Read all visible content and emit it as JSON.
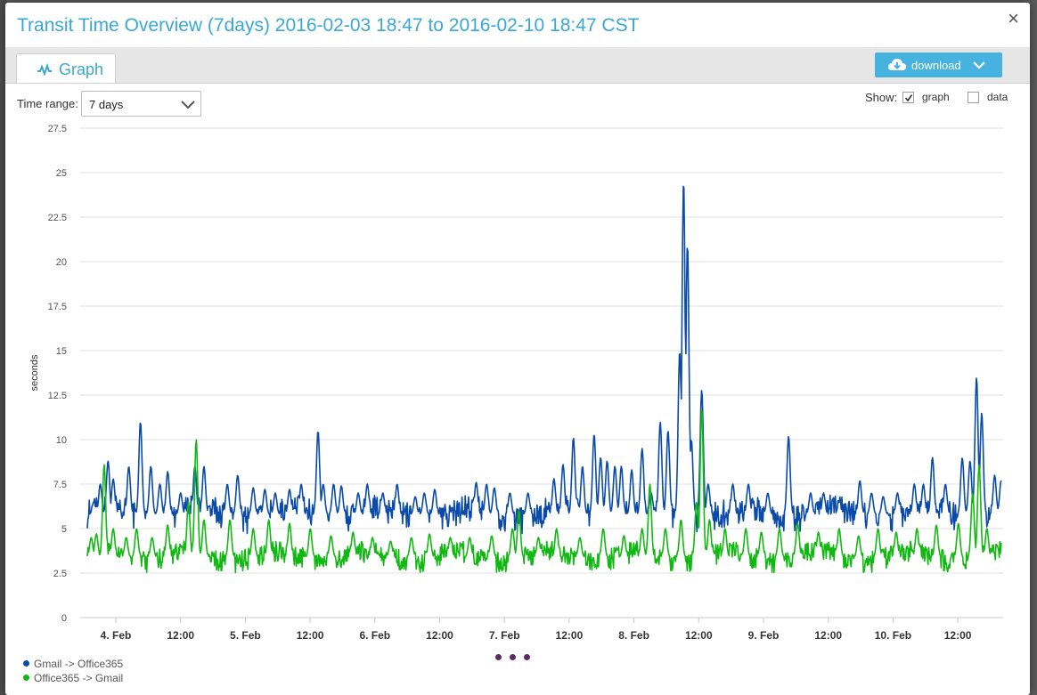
{
  "modal": {
    "title": "Transit Time Overview (7days) 2016-02-03 18:47 to 2016-02-10 18:47 CST",
    "close_label": "×"
  },
  "tabs": [
    {
      "label": "Graph",
      "icon": "line-chart-icon"
    }
  ],
  "download": {
    "label": "download",
    "icon": "cloud-download-icon"
  },
  "controls": {
    "time_range_label": "Time range:",
    "time_range_value": "7 days",
    "show_label": "Show:",
    "graph_label": "graph",
    "graph_checked": true,
    "data_label": "data",
    "data_checked": false
  },
  "colors": {
    "accent": "#3aa8d4",
    "series_blue": "#0a4aa8",
    "series_green": "#12b812",
    "pager": "#5a2a62"
  },
  "chart_data": {
    "type": "line",
    "ylabel": "seconds",
    "ylim": [
      0,
      27.5
    ],
    "yticks": [
      "0",
      "2.5",
      "5",
      "7.5",
      "10",
      "12.5",
      "15",
      "17.5",
      "20",
      "22.5",
      "25",
      "27.5"
    ],
    "xticks": [
      "4. Feb",
      "12:00",
      "5. Feb",
      "12:00",
      "6. Feb",
      "12:00",
      "7. Feb",
      "12:00",
      "8. Feb",
      "12:00",
      "9. Feb",
      "12:00",
      "10. Feb",
      "12:00"
    ],
    "x_start": "2016-02-03 18:47",
    "x_end": "2016-02-10 18:47",
    "grid": true,
    "legend": "bottom-left",
    "series": [
      {
        "name": "Gmail -> Office365",
        "color": "#0a4aa8",
        "baseline": 5.8,
        "peaks": [
          {
            "t": 0.05,
            "v": 6.5
          },
          {
            "t": 0.1,
            "v": 7.5
          },
          {
            "t": 0.16,
            "v": 8.8
          },
          {
            "t": 0.2,
            "v": 7.8
          },
          {
            "t": 0.32,
            "v": 8.5
          },
          {
            "t": 0.41,
            "v": 11.0
          },
          {
            "t": 0.49,
            "v": 8.5
          },
          {
            "t": 0.56,
            "v": 7.5
          },
          {
            "t": 0.62,
            "v": 8.2
          },
          {
            "t": 0.72,
            "v": 7.0
          },
          {
            "t": 0.83,
            "v": 8.5
          },
          {
            "t": 0.9,
            "v": 8.5
          },
          {
            "t": 1.08,
            "v": 7.5
          },
          {
            "t": 1.16,
            "v": 8.0
          },
          {
            "t": 1.28,
            "v": 7.3
          },
          {
            "t": 1.37,
            "v": 7.2
          },
          {
            "t": 1.45,
            "v": 7.0
          },
          {
            "t": 1.56,
            "v": 7.2
          },
          {
            "t": 1.65,
            "v": 7.5
          },
          {
            "t": 1.78,
            "v": 10.5
          },
          {
            "t": 1.82,
            "v": 7.5
          },
          {
            "t": 1.9,
            "v": 7.5
          },
          {
            "t": 1.96,
            "v": 7.4
          },
          {
            "t": 2.09,
            "v": 7.0
          },
          {
            "t": 2.16,
            "v": 7.5
          },
          {
            "t": 2.28,
            "v": 7.0
          },
          {
            "t": 2.39,
            "v": 7.5
          },
          {
            "t": 2.53,
            "v": 6.8
          },
          {
            "t": 2.6,
            "v": 7.0
          },
          {
            "t": 2.68,
            "v": 7.2
          },
          {
            "t": 3.0,
            "v": 7.6
          },
          {
            "t": 3.08,
            "v": 7.5
          },
          {
            "t": 3.14,
            "v": 7.3
          },
          {
            "t": 3.26,
            "v": 7.0
          },
          {
            "t": 3.4,
            "v": 7.0
          },
          {
            "t": 3.6,
            "v": 7.8
          },
          {
            "t": 3.67,
            "v": 8.6
          },
          {
            "t": 3.75,
            "v": 10.1
          },
          {
            "t": 3.82,
            "v": 8.5
          },
          {
            "t": 3.91,
            "v": 10.3
          },
          {
            "t": 3.96,
            "v": 9.0
          },
          {
            "t": 4.01,
            "v": 8.8
          },
          {
            "t": 4.07,
            "v": 8.5
          },
          {
            "t": 4.12,
            "v": 8.5
          },
          {
            "t": 4.2,
            "v": 8.3
          },
          {
            "t": 4.28,
            "v": 9.5
          },
          {
            "t": 4.35,
            "v": 7.0
          },
          {
            "t": 4.42,
            "v": 11.0
          },
          {
            "t": 4.48,
            "v": 10.5
          },
          {
            "t": 4.57,
            "v": 15.0
          },
          {
            "t": 4.6,
            "v": 24.6
          },
          {
            "t": 4.63,
            "v": 21.0
          },
          {
            "t": 4.66,
            "v": 10.0
          },
          {
            "t": 4.74,
            "v": 12.8
          },
          {
            "t": 4.79,
            "v": 7.5
          },
          {
            "t": 4.98,
            "v": 7.5
          },
          {
            "t": 5.1,
            "v": 7.5
          },
          {
            "t": 5.25,
            "v": 7.0
          },
          {
            "t": 5.41,
            "v": 10.2
          },
          {
            "t": 5.58,
            "v": 7.0
          },
          {
            "t": 5.68,
            "v": 7.0
          },
          {
            "t": 5.8,
            "v": 6.5
          },
          {
            "t": 5.96,
            "v": 7.7
          },
          {
            "t": 6.05,
            "v": 7.0
          },
          {
            "t": 6.14,
            "v": 6.8
          },
          {
            "t": 6.25,
            "v": 7.0
          },
          {
            "t": 6.38,
            "v": 7.5
          },
          {
            "t": 6.45,
            "v": 7.5
          },
          {
            "t": 6.52,
            "v": 9.0
          },
          {
            "t": 6.62,
            "v": 7.5
          },
          {
            "t": 6.75,
            "v": 9.0
          },
          {
            "t": 6.81,
            "v": 8.8
          },
          {
            "t": 6.86,
            "v": 13.5
          },
          {
            "t": 6.9,
            "v": 11.5
          },
          {
            "t": 7.0,
            "v": 8.0
          },
          {
            "t": 7.05,
            "v": 7.7
          }
        ]
      },
      {
        "name": "Office365 -> Gmail",
        "color": "#12b812",
        "baseline": 3.4,
        "peaks": [
          {
            "t": 0.03,
            "v": 4.5
          },
          {
            "t": 0.07,
            "v": 4.7
          },
          {
            "t": 0.13,
            "v": 8.6
          },
          {
            "t": 0.2,
            "v": 5.0
          },
          {
            "t": 0.3,
            "v": 4.5
          },
          {
            "t": 0.38,
            "v": 5.0
          },
          {
            "t": 0.5,
            "v": 4.5
          },
          {
            "t": 0.62,
            "v": 5.2
          },
          {
            "t": 0.78,
            "v": 6.5
          },
          {
            "t": 0.84,
            "v": 10.0
          },
          {
            "t": 0.9,
            "v": 5.5
          },
          {
            "t": 1.1,
            "v": 5.5
          },
          {
            "t": 1.28,
            "v": 5.0
          },
          {
            "t": 1.4,
            "v": 5.5
          },
          {
            "t": 1.56,
            "v": 5.3
          },
          {
            "t": 1.72,
            "v": 5.0
          },
          {
            "t": 1.88,
            "v": 4.6
          },
          {
            "t": 2.05,
            "v": 4.8
          },
          {
            "t": 2.2,
            "v": 4.5
          },
          {
            "t": 2.34,
            "v": 4.3
          },
          {
            "t": 2.5,
            "v": 4.5
          },
          {
            "t": 2.64,
            "v": 4.7
          },
          {
            "t": 2.8,
            "v": 4.5
          },
          {
            "t": 2.95,
            "v": 4.5
          },
          {
            "t": 3.12,
            "v": 4.6
          },
          {
            "t": 3.28,
            "v": 5.0
          },
          {
            "t": 3.33,
            "v": 6.0
          },
          {
            "t": 3.48,
            "v": 4.5
          },
          {
            "t": 3.62,
            "v": 5.0
          },
          {
            "t": 3.8,
            "v": 4.5
          },
          {
            "t": 3.98,
            "v": 5.0
          },
          {
            "t": 4.14,
            "v": 4.6
          },
          {
            "t": 4.28,
            "v": 5.0
          },
          {
            "t": 4.34,
            "v": 7.5
          },
          {
            "t": 4.46,
            "v": 5.0
          },
          {
            "t": 4.58,
            "v": 5.5
          },
          {
            "t": 4.7,
            "v": 6.5
          },
          {
            "t": 4.74,
            "v": 11.7
          },
          {
            "t": 4.8,
            "v": 5.5
          },
          {
            "t": 4.92,
            "v": 5.0
          },
          {
            "t": 5.08,
            "v": 5.0
          },
          {
            "t": 5.2,
            "v": 4.8
          },
          {
            "t": 5.34,
            "v": 5.0
          },
          {
            "t": 5.48,
            "v": 5.3
          },
          {
            "t": 5.64,
            "v": 4.8
          },
          {
            "t": 5.8,
            "v": 5.0
          },
          {
            "t": 5.95,
            "v": 4.6
          },
          {
            "t": 6.1,
            "v": 5.0
          },
          {
            "t": 6.24,
            "v": 4.8
          },
          {
            "t": 6.4,
            "v": 5.0
          },
          {
            "t": 6.55,
            "v": 5.2
          },
          {
            "t": 6.72,
            "v": 5.3
          },
          {
            "t": 6.83,
            "v": 7.0
          },
          {
            "t": 6.88,
            "v": 8.6
          },
          {
            "t": 6.94,
            "v": 5.0
          },
          {
            "t": 7.0,
            "v": 2.5
          },
          {
            "t": 7.05,
            "v": 2.8
          }
        ]
      }
    ]
  }
}
